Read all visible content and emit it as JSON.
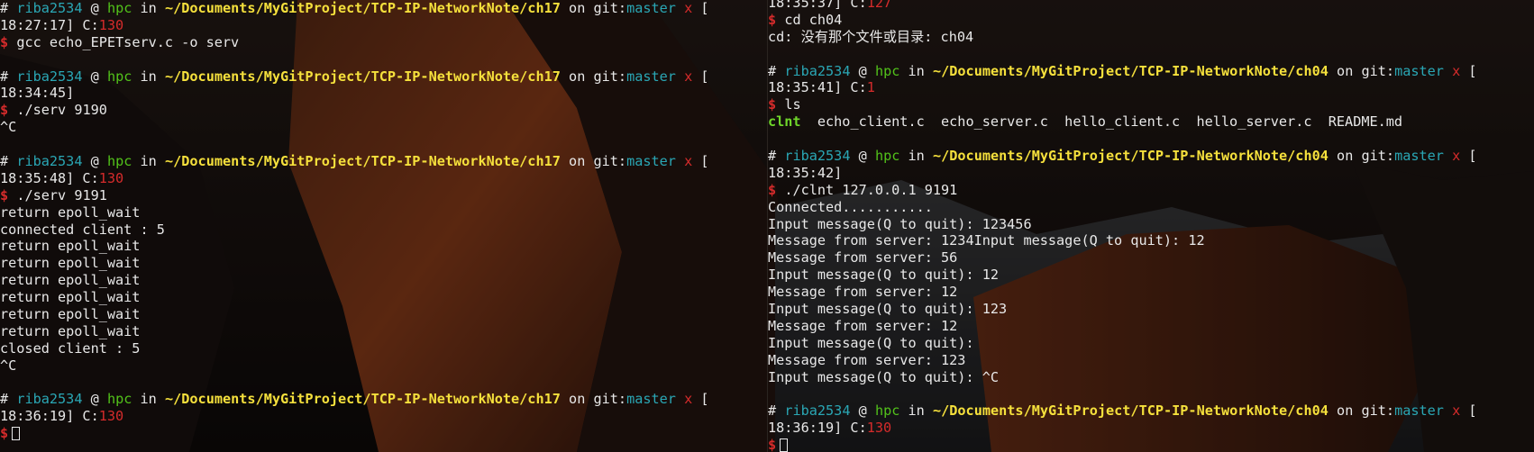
{
  "theme": {
    "user": "#2aa7b5",
    "host": "#52c21a",
    "path": "#f5e03c",
    "error": "#d52b2b",
    "exec": "#6fd62a"
  },
  "prompt_parts": {
    "hash": "#",
    "user": "riba2534",
    "at": "@",
    "host": "hpc",
    "in": "in",
    "on": "on git:",
    "branch": "master",
    "x": "x",
    "dollar": "$"
  },
  "left": {
    "path": "~/Documents/MyGitProject/TCP-IP-NetworkNote/ch17",
    "lines": [
      {
        "type": "prompt"
      },
      {
        "type": "time",
        "time": "18:27:17] C:",
        "code": "130"
      },
      {
        "type": "cmd",
        "cmd": "gcc echo_EPETserv.c -o serv"
      },
      {
        "type": "blank"
      },
      {
        "type": "prompt"
      },
      {
        "type": "time",
        "time": "18:34:45]",
        "code": ""
      },
      {
        "type": "cmd",
        "cmd": "./serv 9190"
      },
      {
        "type": "out",
        "text": "^C"
      },
      {
        "type": "blank"
      },
      {
        "type": "prompt"
      },
      {
        "type": "time",
        "time": "18:35:48] C:",
        "code": "130"
      },
      {
        "type": "cmd",
        "cmd": "./serv 9191"
      },
      {
        "type": "out",
        "text": "return epoll_wait"
      },
      {
        "type": "out",
        "text": "connected client : 5"
      },
      {
        "type": "out",
        "text": "return epoll_wait"
      },
      {
        "type": "out",
        "text": "return epoll_wait"
      },
      {
        "type": "out",
        "text": "return epoll_wait"
      },
      {
        "type": "out",
        "text": "return epoll_wait"
      },
      {
        "type": "out",
        "text": "return epoll_wait"
      },
      {
        "type": "out",
        "text": "return epoll_wait"
      },
      {
        "type": "out",
        "text": "closed client : 5"
      },
      {
        "type": "out",
        "text": "^C"
      },
      {
        "type": "blank"
      },
      {
        "type": "prompt"
      },
      {
        "type": "time",
        "time": "18:36:19] C:",
        "code": "130"
      },
      {
        "type": "cursor"
      }
    ]
  },
  "right": {
    "path": "~/Documents/MyGitProject/TCP-IP-NetworkNote/ch04",
    "lines": [
      {
        "type": "time",
        "time": "18:35:37] C:",
        "code": "127"
      },
      {
        "type": "cmd",
        "cmd": "cd ch04"
      },
      {
        "type": "out",
        "text": "cd: 没有那个文件或目录: ch04"
      },
      {
        "type": "blank"
      },
      {
        "type": "prompt"
      },
      {
        "type": "time",
        "time": "18:35:41] C:",
        "code": "1"
      },
      {
        "type": "cmd",
        "cmd": "ls"
      },
      {
        "type": "ls",
        "exec": "clnt",
        "text": "  echo_client.c  echo_server.c  hello_client.c  hello_server.c  README.md"
      },
      {
        "type": "blank"
      },
      {
        "type": "prompt"
      },
      {
        "type": "time",
        "time": "18:35:42]",
        "code": ""
      },
      {
        "type": "cmd",
        "cmd": "./clnt 127.0.0.1 9191"
      },
      {
        "type": "out",
        "text": "Connected..........."
      },
      {
        "type": "out",
        "text": "Input message(Q to quit): 123456"
      },
      {
        "type": "out",
        "text": "Message from server: 1234Input message(Q to quit): 12"
      },
      {
        "type": "out",
        "text": "Message from server: 56"
      },
      {
        "type": "out",
        "text": "Input message(Q to quit): 12"
      },
      {
        "type": "out",
        "text": "Message from server: 12"
      },
      {
        "type": "out",
        "text": "Input message(Q to quit): 123"
      },
      {
        "type": "out",
        "text": "Message from server: 12"
      },
      {
        "type": "out",
        "text": "Input message(Q to quit):"
      },
      {
        "type": "out",
        "text": "Message from server: 123"
      },
      {
        "type": "out",
        "text": "Input message(Q to quit): ^C"
      },
      {
        "type": "blank"
      },
      {
        "type": "prompt"
      },
      {
        "type": "time",
        "time": "18:36:19] C:",
        "code": "130"
      },
      {
        "type": "cursor"
      }
    ]
  }
}
